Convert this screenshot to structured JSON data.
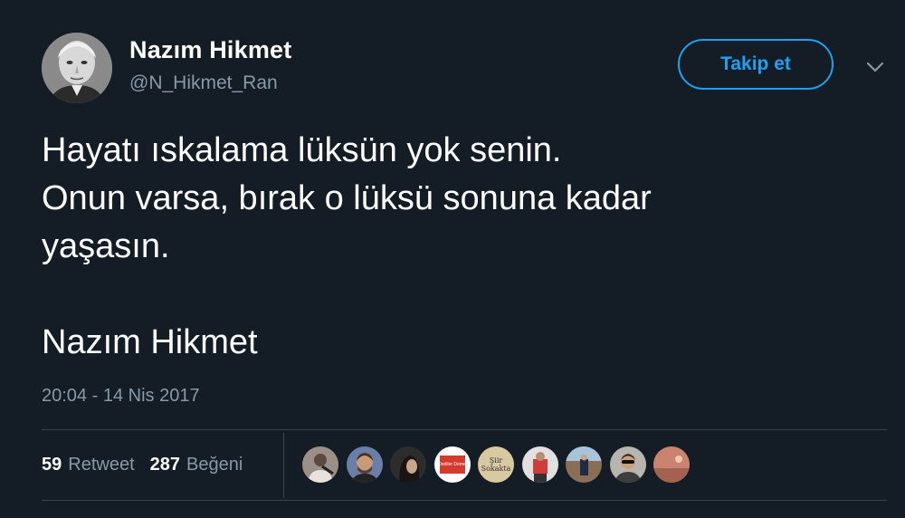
{
  "author": {
    "name": "Nazım Hikmet",
    "handle": "@N_Hikmet_Ran"
  },
  "follow_button": {
    "label": "Takip et"
  },
  "tweet": {
    "lines": [
      "Hayatı ıskalama lüksün yok senin.",
      "Onun varsa, bırak o lüksü sonuna kadar",
      "yaşasın.",
      "",
      "Nazım Hikmet"
    ],
    "timestamp": "20:04 - 14 Nis 2017"
  },
  "stats": {
    "retweets": {
      "count": "59",
      "label": "Retweet"
    },
    "likes": {
      "count": "287",
      "label": "Beğeni"
    }
  },
  "liker_avatars": [
    {
      "name": "liker-1",
      "color": "#9b8f88"
    },
    {
      "name": "liker-2",
      "color": "#6a7fa8"
    },
    {
      "name": "liker-3",
      "color": "#2c2c2c"
    },
    {
      "name": "liker-4",
      "color": "#ffffff",
      "text": "Dediler Deme"
    },
    {
      "name": "liker-5",
      "color": "#d8c9a0",
      "text": "Şiir Sokakta"
    },
    {
      "name": "liker-6",
      "color": "#e0e0e0"
    },
    {
      "name": "liker-7",
      "color": "#8a6e55"
    },
    {
      "name": "liker-8",
      "color": "#b8b5ae"
    },
    {
      "name": "liker-9",
      "color": "#c98370"
    }
  ],
  "colors": {
    "background": "#141d26",
    "accent": "#1da1f2",
    "secondary_text": "#8899a6",
    "divider": "#38444d"
  },
  "icons": {
    "menu": "chevron-down-icon"
  }
}
